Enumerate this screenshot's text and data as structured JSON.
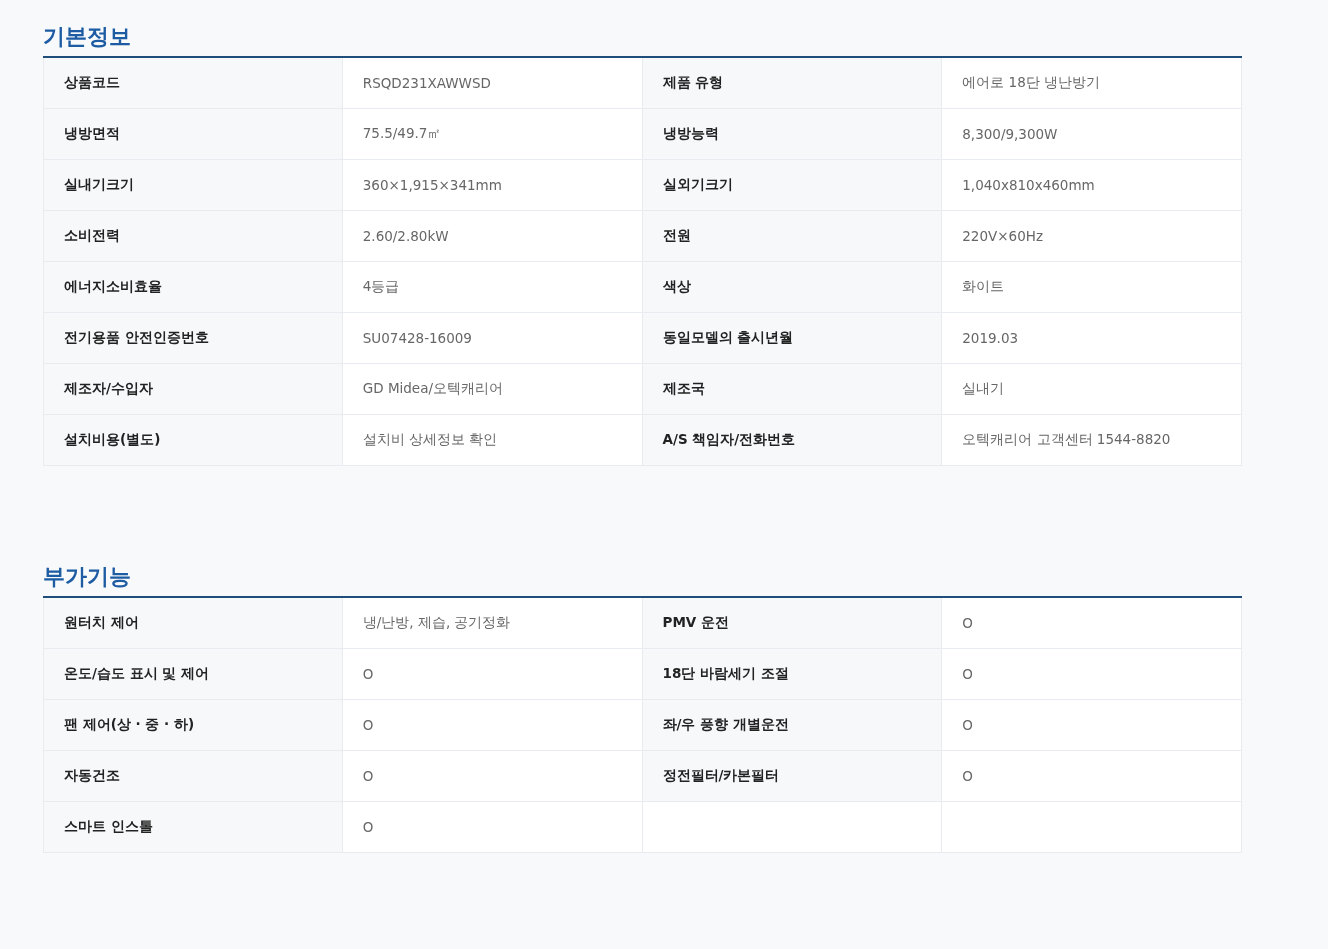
{
  "sections": [
    {
      "title": "기본정보",
      "rows": [
        [
          {
            "label": "상품코드",
            "value": "RSQD231XAWWSD"
          },
          {
            "label": "제품 유형",
            "value": "에어로 18단 냉난방기"
          }
        ],
        [
          {
            "label": "냉방면적",
            "value": "75.5/49.7㎡"
          },
          {
            "label": "냉방능력",
            "value": "8,300/9,300W"
          }
        ],
        [
          {
            "label": "실내기크기",
            "value": "360×1,915×341mm"
          },
          {
            "label": "실외기크기",
            "value": "1,040x810x460mm"
          }
        ],
        [
          {
            "label": "소비전력",
            "value": "2.60/2.80kW"
          },
          {
            "label": "전원",
            "value": "220V×60Hz"
          }
        ],
        [
          {
            "label": "에너지소비효율",
            "value": "4등급"
          },
          {
            "label": "색상",
            "value": "화이트"
          }
        ],
        [
          {
            "label": "전기용품 안전인증번호",
            "value": "SU07428-16009"
          },
          {
            "label": "동일모델의 출시년월",
            "value": "2019.03"
          }
        ],
        [
          {
            "label": "제조자/수입자",
            "value": "GD Midea/오텍캐리어"
          },
          {
            "label": "제조국",
            "value": "실내기"
          }
        ],
        [
          {
            "label": "설치비용(별도)",
            "value": "설치비 상세정보 확인"
          },
          {
            "label": "A/S 책임자/전화번호",
            "value": "오텍캐리어 고객센터 1544-8820"
          }
        ]
      ]
    },
    {
      "title": "부가기능",
      "rows": [
        [
          {
            "label": "원터치 제어",
            "value": "냉/난방, 제습, 공기정화"
          },
          {
            "label": "PMV 운전",
            "value": "O"
          }
        ],
        [
          {
            "label": "온도/습도 표시 및 제어",
            "value": "O"
          },
          {
            "label": "18단 바람세기 조절",
            "value": "O"
          }
        ],
        [
          {
            "label": "팬 제어(상 · 중 · 하)",
            "value": "O"
          },
          {
            "label": "좌/우 풍향 개별운전",
            "value": "O"
          }
        ],
        [
          {
            "label": "자동건조",
            "value": "O"
          },
          {
            "label": "정전필터/카본필터",
            "value": "O"
          }
        ],
        [
          {
            "label": "스마트 인스톨",
            "value": "O"
          }
        ]
      ]
    }
  ]
}
